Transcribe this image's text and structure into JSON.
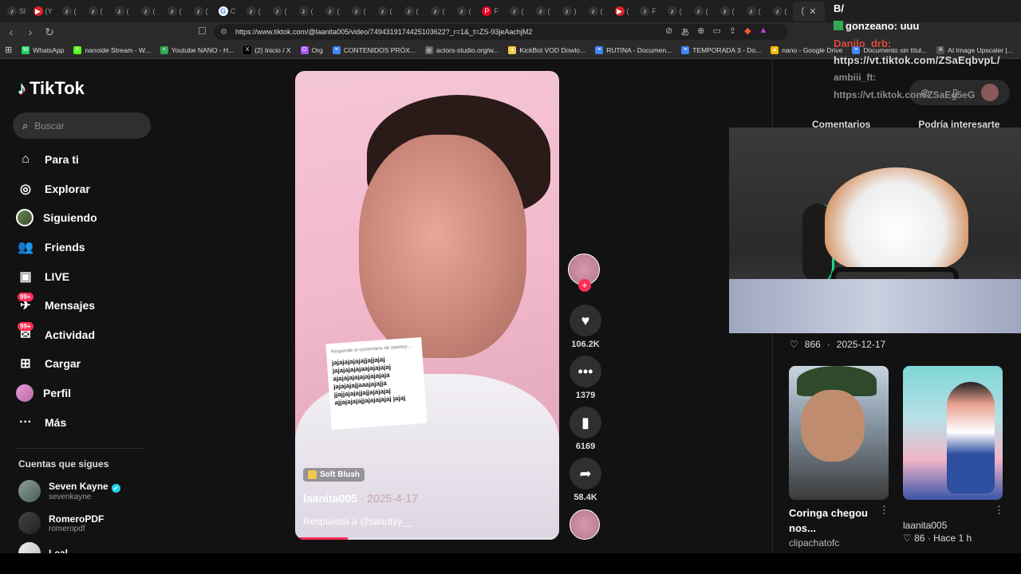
{
  "browser": {
    "tabs": [
      {
        "icon": "tiktok-icon",
        "text": "Sl"
      },
      {
        "icon": "youtube-icon",
        "text": "(Y"
      },
      {
        "icon": "tiktok-icon",
        "text": "("
      },
      {
        "icon": "tiktok-icon",
        "text": "("
      },
      {
        "icon": "tiktok-icon",
        "text": "("
      },
      {
        "icon": "tiktok-icon",
        "text": "("
      },
      {
        "icon": "tiktok-icon",
        "text": "("
      },
      {
        "icon": "tiktok-icon",
        "text": "("
      },
      {
        "icon": "google-icon",
        "text": "C"
      },
      {
        "icon": "tiktok-icon",
        "text": "("
      },
      {
        "icon": "tiktok-icon",
        "text": "("
      },
      {
        "icon": "tiktok-icon",
        "text": "("
      },
      {
        "icon": "tiktok-icon",
        "text": "("
      },
      {
        "icon": "tiktok-icon",
        "text": "("
      },
      {
        "icon": "tiktok-icon",
        "text": "("
      },
      {
        "icon": "tiktok-icon",
        "text": "("
      },
      {
        "icon": "tiktok-icon",
        "text": "("
      },
      {
        "icon": "tiktok-icon",
        "text": "("
      },
      {
        "icon": "pinterest-icon",
        "text": "F"
      },
      {
        "icon": "tiktok-icon",
        "text": "("
      },
      {
        "icon": "tiktok-icon",
        "text": "("
      },
      {
        "icon": "tiktok-icon",
        "text": ")"
      },
      {
        "icon": "tiktok-icon",
        "text": "("
      },
      {
        "icon": "youtube-icon",
        "text": "("
      },
      {
        "icon": "tiktok-icon",
        "text": "F"
      },
      {
        "icon": "tiktok-icon",
        "text": "("
      },
      {
        "icon": "tiktok-icon",
        "text": "("
      },
      {
        "icon": "tiktok-icon",
        "text": "("
      },
      {
        "icon": "tiktok-icon",
        "text": "("
      },
      {
        "icon": "tiktok-icon",
        "text": "("
      }
    ],
    "active_tab_text": "(",
    "url": "https://www.tiktok.com/@laanita005/video/7494319174425103622?_r=1&_t=ZS-93jeAachjM2",
    "bookmarks": [
      {
        "label": "WhatsApp",
        "color": "#25d366",
        "glyph": "W"
      },
      {
        "label": "nanoide Stream - W...",
        "color": "#53fc18",
        "glyph": "K"
      },
      {
        "label": "Youtube NANO - H...",
        "color": "#34a853",
        "glyph": "+"
      },
      {
        "label": "(2) Inicio / X",
        "color": "#000000",
        "glyph": "X"
      },
      {
        "label": "Org",
        "color": "#a855f7",
        "glyph": "O"
      },
      {
        "label": "CONTENIDOS PRÓX...",
        "color": "#4285f4",
        "glyph": "≡"
      },
      {
        "label": "actors-studio.org/w...",
        "color": "#666666",
        "glyph": "◎"
      },
      {
        "label": "KickBot VOD Dowlo...",
        "color": "#f2c94c",
        "glyph": "✦"
      },
      {
        "label": "RUTINA - Documen...",
        "color": "#4285f4",
        "glyph": "≡"
      },
      {
        "label": "TEMPORADA 3 - Do...",
        "color": "#4285f4",
        "glyph": "≡"
      },
      {
        "label": "nano - Google Drive",
        "color": "#fbbc04",
        "glyph": "▲"
      },
      {
        "label": "Documento sin títul...",
        "color": "#4285f4",
        "glyph": "≡"
      },
      {
        "label": "AI Image Upscaler |...",
        "color": "#555555",
        "glyph": "A"
      }
    ]
  },
  "chat": {
    "line1": "B/",
    "line2": "gonzeano: uuu",
    "line3": "Danilo_drb:",
    "url": "https://vt.tiktok.com/ZSaEqbvpL/",
    "line5": "ambiii_ft:",
    "line6": "https://vt.tiktok.com/ZSaEg5eG"
  },
  "sidebar": {
    "brand": "TikTok",
    "search_placeholder": "Buscar",
    "nav": [
      {
        "label": "Para ti",
        "icon": "home-icon",
        "glyph": "⌂"
      },
      {
        "label": "Explorar",
        "icon": "compass-icon",
        "glyph": "◎"
      },
      {
        "label": "Siguiendo",
        "icon": "following-avatar-icon",
        "glyph": ""
      },
      {
        "label": "Friends",
        "icon": "friends-icon",
        "glyph": "👥"
      },
      {
        "label": "LIVE",
        "icon": "live-icon",
        "glyph": "▣"
      },
      {
        "label": "Mensajes",
        "icon": "messages-icon",
        "glyph": "✈",
        "badge": "99+"
      },
      {
        "label": "Actividad",
        "icon": "activity-icon",
        "glyph": "✉",
        "badge": "99+"
      },
      {
        "label": "Cargar",
        "icon": "upload-icon",
        "glyph": "⊞"
      },
      {
        "label": "Perfil",
        "icon": "profile-avatar-icon",
        "glyph": ""
      },
      {
        "label": "Más",
        "icon": "more-icon",
        "glyph": "···"
      }
    ],
    "following_title": "Cuentas que sigues",
    "following": [
      {
        "name": "Seven Kayne",
        "handle": "sevenkayne",
        "verified": true
      },
      {
        "name": "RomeroPDF",
        "handle": "romeropdf",
        "verified": false
      },
      {
        "name": "Leal",
        "handle": "",
        "verified": false
      }
    ]
  },
  "video": {
    "comment_header": "Responde al comentario de saantyy...",
    "comment_text": "jajajajajajajjajjajaj jajajajajajaajajajajaj ajajajajajajajajajaja jajajajajjaaajajajja jjajjajajajjajjajajajaj ajjajajajajjajajajajaj jajaj",
    "effect_label": "Soft Blush",
    "author": "laanita005",
    "date": "2025-4-17",
    "description": "Respuesta a @saantyy__",
    "progress": 0.2
  },
  "actions": {
    "likes": "106.2K",
    "comments": "1379",
    "saves": "6169",
    "shares": "58.4K"
  },
  "right_panel": {
    "tabs": [
      "Comentarios",
      "Podría interesarte"
    ],
    "prev_stats": {
      "likes": "866",
      "date": "2025-12-17"
    },
    "cards": [
      {
        "title": "Coringa chegou nos...",
        "author": "clipachatofc"
      },
      {
        "author": "laanita005",
        "likes": "86",
        "time": "Hace 1 h"
      }
    ]
  }
}
